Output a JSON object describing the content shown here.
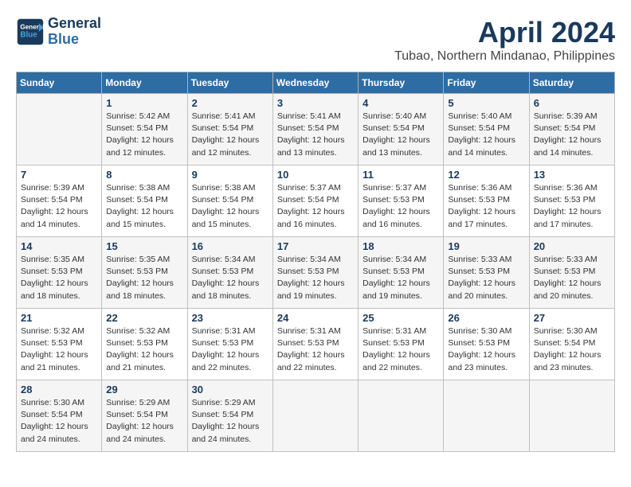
{
  "logo": {
    "line1": "General",
    "line2": "Blue"
  },
  "title": "April 2024",
  "location": "Tubao, Northern Mindanao, Philippines",
  "days_of_week": [
    "Sunday",
    "Monday",
    "Tuesday",
    "Wednesday",
    "Thursday",
    "Friday",
    "Saturday"
  ],
  "weeks": [
    [
      {
        "day": "",
        "info": ""
      },
      {
        "day": "1",
        "info": "Sunrise: 5:42 AM\nSunset: 5:54 PM\nDaylight: 12 hours\nand 12 minutes."
      },
      {
        "day": "2",
        "info": "Sunrise: 5:41 AM\nSunset: 5:54 PM\nDaylight: 12 hours\nand 12 minutes."
      },
      {
        "day": "3",
        "info": "Sunrise: 5:41 AM\nSunset: 5:54 PM\nDaylight: 12 hours\nand 13 minutes."
      },
      {
        "day": "4",
        "info": "Sunrise: 5:40 AM\nSunset: 5:54 PM\nDaylight: 12 hours\nand 13 minutes."
      },
      {
        "day": "5",
        "info": "Sunrise: 5:40 AM\nSunset: 5:54 PM\nDaylight: 12 hours\nand 14 minutes."
      },
      {
        "day": "6",
        "info": "Sunrise: 5:39 AM\nSunset: 5:54 PM\nDaylight: 12 hours\nand 14 minutes."
      }
    ],
    [
      {
        "day": "7",
        "info": "Sunrise: 5:39 AM\nSunset: 5:54 PM\nDaylight: 12 hours\nand 14 minutes."
      },
      {
        "day": "8",
        "info": "Sunrise: 5:38 AM\nSunset: 5:54 PM\nDaylight: 12 hours\nand 15 minutes."
      },
      {
        "day": "9",
        "info": "Sunrise: 5:38 AM\nSunset: 5:54 PM\nDaylight: 12 hours\nand 15 minutes."
      },
      {
        "day": "10",
        "info": "Sunrise: 5:37 AM\nSunset: 5:54 PM\nDaylight: 12 hours\nand 16 minutes."
      },
      {
        "day": "11",
        "info": "Sunrise: 5:37 AM\nSunset: 5:53 PM\nDaylight: 12 hours\nand 16 minutes."
      },
      {
        "day": "12",
        "info": "Sunrise: 5:36 AM\nSunset: 5:53 PM\nDaylight: 12 hours\nand 17 minutes."
      },
      {
        "day": "13",
        "info": "Sunrise: 5:36 AM\nSunset: 5:53 PM\nDaylight: 12 hours\nand 17 minutes."
      }
    ],
    [
      {
        "day": "14",
        "info": "Sunrise: 5:35 AM\nSunset: 5:53 PM\nDaylight: 12 hours\nand 18 minutes."
      },
      {
        "day": "15",
        "info": "Sunrise: 5:35 AM\nSunset: 5:53 PM\nDaylight: 12 hours\nand 18 minutes."
      },
      {
        "day": "16",
        "info": "Sunrise: 5:34 AM\nSunset: 5:53 PM\nDaylight: 12 hours\nand 18 minutes."
      },
      {
        "day": "17",
        "info": "Sunrise: 5:34 AM\nSunset: 5:53 PM\nDaylight: 12 hours\nand 19 minutes."
      },
      {
        "day": "18",
        "info": "Sunrise: 5:34 AM\nSunset: 5:53 PM\nDaylight: 12 hours\nand 19 minutes."
      },
      {
        "day": "19",
        "info": "Sunrise: 5:33 AM\nSunset: 5:53 PM\nDaylight: 12 hours\nand 20 minutes."
      },
      {
        "day": "20",
        "info": "Sunrise: 5:33 AM\nSunset: 5:53 PM\nDaylight: 12 hours\nand 20 minutes."
      }
    ],
    [
      {
        "day": "21",
        "info": "Sunrise: 5:32 AM\nSunset: 5:53 PM\nDaylight: 12 hours\nand 21 minutes."
      },
      {
        "day": "22",
        "info": "Sunrise: 5:32 AM\nSunset: 5:53 PM\nDaylight: 12 hours\nand 21 minutes."
      },
      {
        "day": "23",
        "info": "Sunrise: 5:31 AM\nSunset: 5:53 PM\nDaylight: 12 hours\nand 22 minutes."
      },
      {
        "day": "24",
        "info": "Sunrise: 5:31 AM\nSunset: 5:53 PM\nDaylight: 12 hours\nand 22 minutes."
      },
      {
        "day": "25",
        "info": "Sunrise: 5:31 AM\nSunset: 5:53 PM\nDaylight: 12 hours\nand 22 minutes."
      },
      {
        "day": "26",
        "info": "Sunrise: 5:30 AM\nSunset: 5:53 PM\nDaylight: 12 hours\nand 23 minutes."
      },
      {
        "day": "27",
        "info": "Sunrise: 5:30 AM\nSunset: 5:54 PM\nDaylight: 12 hours\nand 23 minutes."
      }
    ],
    [
      {
        "day": "28",
        "info": "Sunrise: 5:30 AM\nSunset: 5:54 PM\nDaylight: 12 hours\nand 24 minutes."
      },
      {
        "day": "29",
        "info": "Sunrise: 5:29 AM\nSunset: 5:54 PM\nDaylight: 12 hours\nand 24 minutes."
      },
      {
        "day": "30",
        "info": "Sunrise: 5:29 AM\nSunset: 5:54 PM\nDaylight: 12 hours\nand 24 minutes."
      },
      {
        "day": "",
        "info": ""
      },
      {
        "day": "",
        "info": ""
      },
      {
        "day": "",
        "info": ""
      },
      {
        "day": "",
        "info": ""
      }
    ]
  ]
}
